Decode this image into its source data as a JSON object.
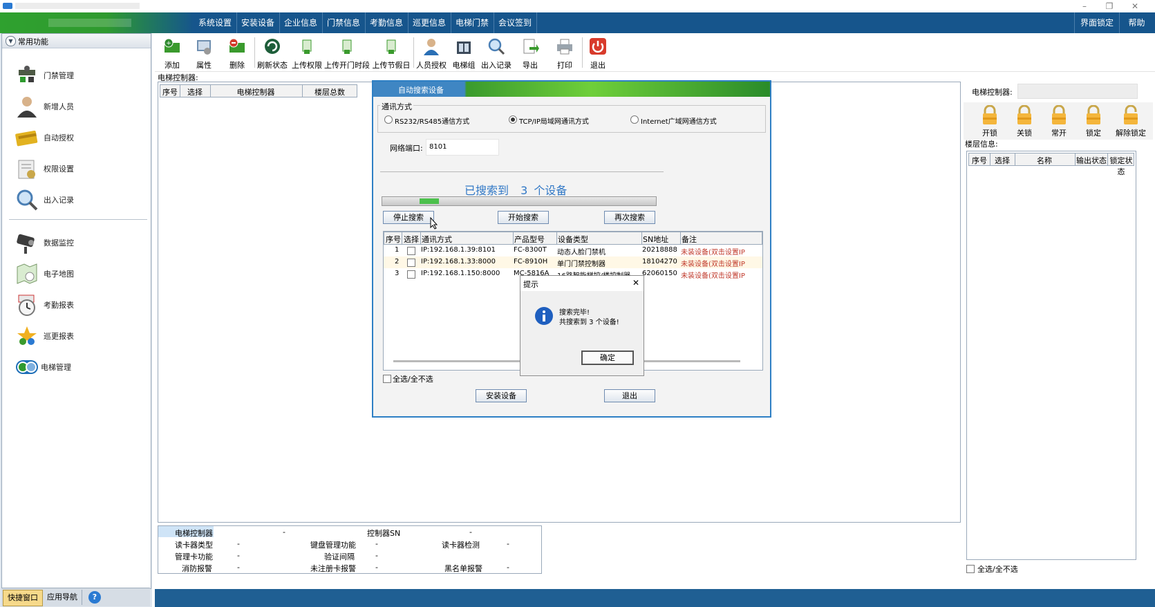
{
  "menubar": {
    "items": [
      "系统设置",
      "安装设备",
      "企业信息",
      "门禁信息",
      "考勤信息",
      "巡更信息",
      "电梯门禁",
      "会议签到"
    ],
    "right_items": [
      "界面锁定",
      "帮助"
    ]
  },
  "sidebar": {
    "header": "常用功能",
    "items": [
      {
        "label": "门禁管理",
        "icon": "door-control-icon"
      },
      {
        "label": "新增人员",
        "icon": "person-icon"
      },
      {
        "label": "自动授权",
        "icon": "card-icon"
      },
      {
        "label": "权限设置",
        "icon": "permission-icon"
      },
      {
        "label": "出入记录",
        "icon": "magnifier-icon"
      },
      {
        "label": "数据监控",
        "icon": "camera-icon"
      },
      {
        "label": "电子地图",
        "icon": "map-icon"
      },
      {
        "label": "考勤报表",
        "icon": "clock-icon"
      },
      {
        "label": "巡更报表",
        "icon": "patrol-icon"
      },
      {
        "label": "电梯管理",
        "icon": "elevator-icon"
      }
    ],
    "bottom_tabs": [
      "快捷窗口",
      "应用导航"
    ]
  },
  "toolbar": {
    "items": [
      {
        "label": "添加",
        "icon": "add-icon"
      },
      {
        "label": "属性",
        "icon": "properties-icon"
      },
      {
        "label": "删除",
        "icon": "delete-icon"
      },
      {
        "label": "刷新状态",
        "icon": "refresh-icon"
      },
      {
        "label": "上传权限",
        "icon": "upload-icon"
      },
      {
        "label": "上传开门时段",
        "icon": "upload-icon"
      },
      {
        "label": "上传节假日",
        "icon": "upload-icon"
      },
      {
        "label": "人员授权",
        "icon": "person-auth-icon"
      },
      {
        "label": "电梯组",
        "icon": "elevator-group-icon"
      },
      {
        "label": "出入记录",
        "icon": "magnifier-icon"
      },
      {
        "label": "导出",
        "icon": "export-icon"
      },
      {
        "label": "打印",
        "icon": "printer-icon"
      },
      {
        "label": "退出",
        "icon": "power-icon"
      }
    ]
  },
  "main": {
    "controller_label": "电梯控制器:",
    "columns": [
      "序号",
      "选择",
      "电梯控制器",
      "楼层总数"
    ]
  },
  "bottom_info": {
    "rows": [
      [
        {
          "k": "电梯控制器",
          "v": "-"
        },
        {
          "k": "控制器SN",
          "v": "-"
        }
      ],
      [
        {
          "k": "读卡器类型",
          "v": "-"
        },
        {
          "k": "键盘管理功能",
          "v": "-"
        },
        {
          "k": "读卡器检测",
          "v": "-"
        }
      ],
      [
        {
          "k": "管理卡功能",
          "v": "-"
        },
        {
          "k": "验证间隔",
          "v": "-"
        }
      ],
      [
        {
          "k": "消防报警",
          "v": "-"
        },
        {
          "k": "未注册卡报警",
          "v": "-"
        },
        {
          "k": "黑名单报警",
          "v": "-"
        }
      ]
    ]
  },
  "right": {
    "controller_label": "电梯控制器:",
    "locks": [
      "开锁",
      "关锁",
      "常开",
      "锁定",
      "解除锁定"
    ],
    "floor_label": "楼层信息:",
    "columns": [
      "序号",
      "选择",
      "名称",
      "输出状态",
      "锁定状态"
    ],
    "select_all": "全选/全不选"
  },
  "dialog": {
    "title": "自动搜索设备",
    "comm_label": "通讯方式",
    "options": [
      "RS232/RS485通信方式",
      "TCP/IP局域网通讯方式",
      "Internet广域网通信方式"
    ],
    "selected_option": 1,
    "port_label": "网络端口:",
    "port_value": "8101",
    "found_text": "已搜索到",
    "found_count": "3",
    "found_unit": "个设备",
    "buttons": {
      "stop": "停止搜索",
      "start": "开始搜索",
      "again": "再次搜索",
      "install": "安装设备",
      "exit": "退出"
    },
    "columns": [
      "序号",
      "选择",
      "通讯方式",
      "产品型号",
      "设备类型",
      "SN地址",
      "备注"
    ],
    "rows": [
      {
        "no": "1",
        "comm": "IP:192.168.1.39:8101",
        "model": "FC-8300T",
        "type": "动态人脸门禁机",
        "sn": "20218888",
        "note": "未装设备(双击设置IP"
      },
      {
        "no": "2",
        "comm": "IP:192.168.1.33:8000",
        "model": "FC-8910H",
        "type": "单门门禁控制器",
        "sn": "18104270",
        "note": "未装设备(双击设置IP"
      },
      {
        "no": "3",
        "comm": "IP:192.168.1.150:8000",
        "model": "MC-5816A",
        "type": "16路智能梯控/楼控制器",
        "sn": "62060150",
        "note": "未装设备(双击设置IP"
      }
    ],
    "select_all": "全选/全不选"
  },
  "msgbox": {
    "title": "提示",
    "line1": "搜索完毕!",
    "line2": "共搜索到 3 个设备!",
    "ok": "确定"
  },
  "colors": {
    "menubar_bg": "#16558c",
    "accent_blue": "#2e7fc4",
    "green": "#3a9a2d",
    "note_red": "#c0392b"
  }
}
